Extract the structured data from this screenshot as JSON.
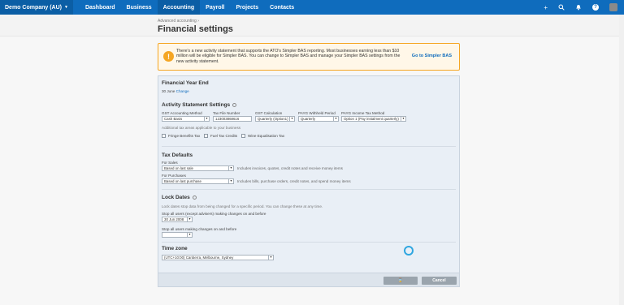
{
  "nav": {
    "org": "Demo Company (AU)",
    "links": [
      "Dashboard",
      "Business",
      "Accounting",
      "Payroll",
      "Projects",
      "Contacts"
    ],
    "active": "Accounting",
    "icons": [
      "plus-icon",
      "search-icon",
      "bell-icon",
      "help-icon",
      "avatar"
    ]
  },
  "header": {
    "breadcrumb": "Advanced accounting ›",
    "title": "Financial settings"
  },
  "notice": {
    "text": "There's a new activity statement that supports the ATO's Simpler BAS reporting. Most businesses earning less than $10 million will be eligible for Simpler BAS. You can change to Simpler BAS and manage your Simpler BAS settings from the new activity statement.",
    "link": "Go to Simpler BAS",
    "accent": "#f5a623"
  },
  "fye": {
    "title": "Financial Year End",
    "value": "30 June",
    "change": "Change"
  },
  "activity": {
    "title": "Activity Statement Settings",
    "gst_method_label": "GST Accounting Method",
    "gst_method_value": "Cash Basis",
    "tfn_label": "Tax File Number",
    "tfn_value": "123003868616",
    "gst_calc_label": "GST Calculation",
    "gst_calc_value": "Quarterly (Option1)",
    "payg_w_label": "PAYG Withheld Period",
    "payg_w_value": "Quarterly",
    "payg_i_label": "PAYG Income Tax Method",
    "payg_i_value": "Option 1 (Pay instalment quarterly)",
    "additional_label": "Additional tax areas applicable to your business",
    "checks": [
      "Fringe Benefits Tax",
      "Fuel Tax Credits",
      "Wine Equalisation Tax"
    ]
  },
  "tax_defaults": {
    "title": "Tax Defaults",
    "sales_label": "For Sales",
    "sales_value": "Based on last sale",
    "sales_note": "Includes invoices, quotes, credit notes and receive money items",
    "purch_label": "For Purchases",
    "purch_value": "Based on last purchase",
    "purch_note": "Includes bills, purchase orders, credit notes, and spend money items"
  },
  "lock": {
    "title": "Lock Dates",
    "desc": "Lock dates stop data from being changed for a specific period. You can change these at any time.",
    "stop_label": "Stop all users (except advisers) making changes on and before",
    "stop_value": "30 Jun 2008",
    "all_label": "Stop all users making changes on and before",
    "all_value": ""
  },
  "timezone": {
    "title": "Time zone",
    "value": "(UTC+10:00) Canberra, Melbourne, Sydney"
  },
  "buttons": {
    "save": "⌛",
    "cancel": "Cancel"
  }
}
